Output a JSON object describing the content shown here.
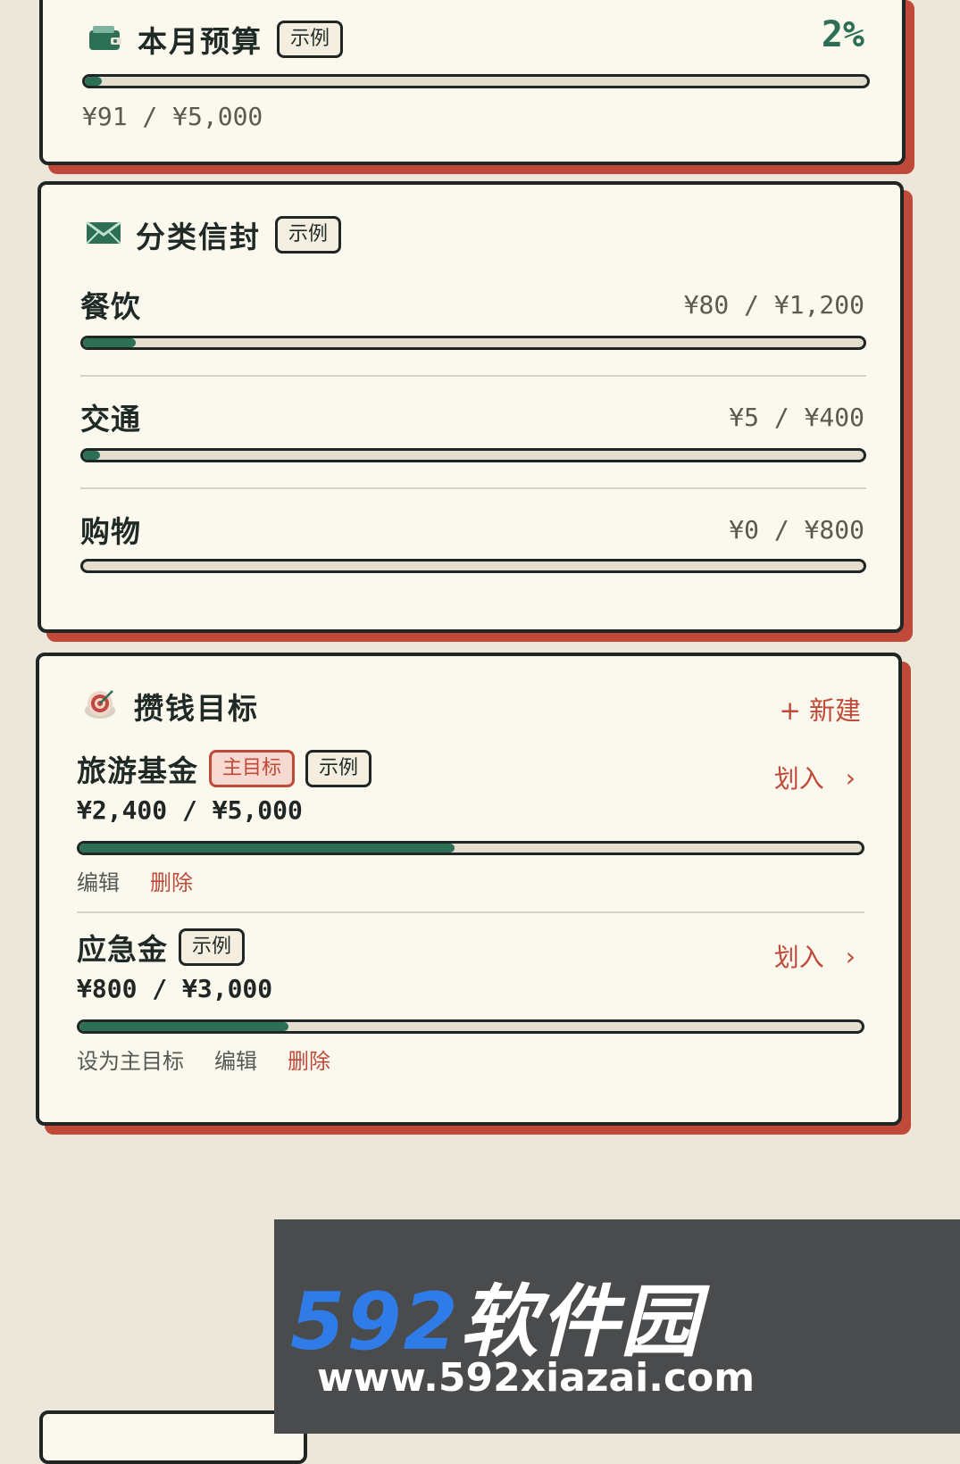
{
  "budget": {
    "title": "本月预算",
    "tag": "示例",
    "percent": "2%",
    "progress": 0.02,
    "amount": "¥91 / ¥5,000"
  },
  "envelopes": {
    "title": "分类信封",
    "tag": "示例",
    "items": [
      {
        "name": "餐饮",
        "amount": "¥80 / ¥1,200",
        "progress": 0.067
      },
      {
        "name": "交通",
        "amount": "¥5 / ¥400",
        "progress": 0.0125
      },
      {
        "name": "购物",
        "amount": "¥0 / ¥800",
        "progress": 0
      }
    ]
  },
  "savings": {
    "title": "攒钱目标",
    "new_label": "+ 新建",
    "goals": [
      {
        "name": "旅游基金",
        "main_tag": "主目标",
        "tag": "示例",
        "amount": "¥2,400 / ¥5,000",
        "progress": 0.48,
        "transfer": "划入",
        "edit": "编辑",
        "delete": "删除"
      },
      {
        "name": "应急金",
        "tag": "示例",
        "amount": "¥800 / ¥3,000",
        "progress": 0.267,
        "transfer": "划入",
        "set_main": "设为主目标",
        "edit": "编辑",
        "delete": "删除"
      }
    ]
  },
  "watermark": {
    "logo_num": "592",
    "logo_cn": "软件园",
    "url": "www.592xiazai.com"
  },
  "colors": {
    "accent_green": "#2d6f55",
    "accent_red": "#bf4a3a",
    "card_bg": "#fbf8ee",
    "page_bg": "#ece7da"
  }
}
